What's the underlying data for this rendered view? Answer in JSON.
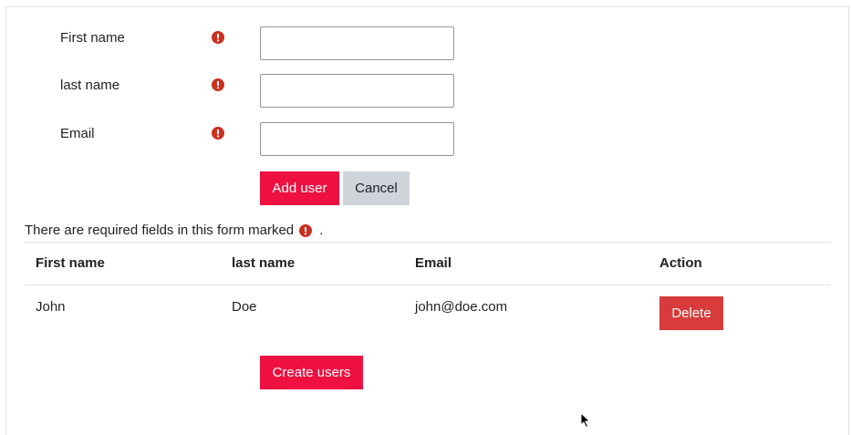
{
  "form": {
    "fields": [
      {
        "label": "First name",
        "value": "",
        "required": true
      },
      {
        "label": "last name",
        "value": "",
        "required": true
      },
      {
        "label": "Email",
        "value": "",
        "required": true
      }
    ],
    "add_button": "Add user",
    "cancel_button": "Cancel",
    "required_note_prefix": "There are required fields in this form marked",
    "required_note_suffix": "."
  },
  "table": {
    "headers": [
      "First name",
      "last name",
      "Email",
      "Action"
    ],
    "rows": [
      {
        "first_name": "John",
        "last_name": "Doe",
        "email": "john@doe.com",
        "action": "Delete"
      }
    ]
  },
  "create_button": "Create users",
  "icons": {
    "required": "exclamation-circle-icon",
    "cursor": "mouse-pointer-icon"
  },
  "colors": {
    "primary": "#ee1040",
    "secondary": "#ced4da",
    "danger": "#d73b3b",
    "required_icon": "#ca3120",
    "border": "#dee2e6"
  }
}
